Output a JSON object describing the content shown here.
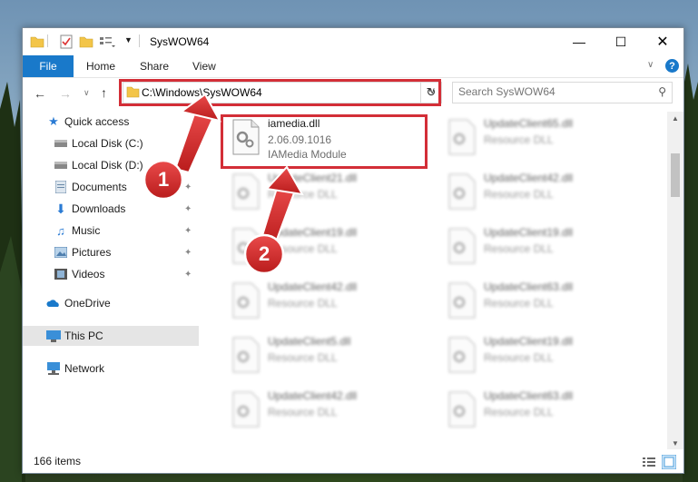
{
  "window": {
    "title": "SysWOW64"
  },
  "ribbon": {
    "file": "File",
    "home": "Home",
    "share": "Share",
    "view": "View"
  },
  "navigation": {
    "address_path": "C:\\Windows\\SysWOW64",
    "search_placeholder": "Search SysWOW64"
  },
  "sidebar": {
    "items": [
      {
        "label": "Quick access",
        "icon": "star-icon"
      },
      {
        "label": "Local Disk (C:)",
        "icon": "drive-icon"
      },
      {
        "label": "Local Disk (D:)",
        "icon": "drive-icon"
      },
      {
        "label": "Documents",
        "icon": "documents-icon"
      },
      {
        "label": "Downloads",
        "icon": "download-icon"
      },
      {
        "label": "Music",
        "icon": "music-icon"
      },
      {
        "label": "Pictures",
        "icon": "pictures-icon"
      },
      {
        "label": "Videos",
        "icon": "videos-icon"
      },
      {
        "label": "OneDrive",
        "icon": "cloud-icon"
      },
      {
        "label": "This PC",
        "icon": "computer-icon"
      },
      {
        "label": "Network",
        "icon": "network-icon"
      }
    ]
  },
  "files": {
    "highlighted": {
      "name": "iamedia.dll",
      "version": "2.06.09.1016",
      "description": "IAMedia Module"
    },
    "blurred": [
      {
        "name": "UpdateClient65.dll",
        "type": "Resource DLL"
      },
      {
        "name": "UpdateClient21.dll",
        "type": "Resource DLL"
      },
      {
        "name": "UpdateClient42.dll",
        "type": "Resource DLL"
      },
      {
        "name": "UpdateClient19.dll",
        "type": "Resource DLL"
      },
      {
        "name": "UpdateClient19.dll",
        "type": "Resource DLL"
      },
      {
        "name": "UpdateClient42.dll",
        "type": "Resource DLL"
      },
      {
        "name": "UpdateClient63.dll",
        "type": "Resource DLL"
      },
      {
        "name": "UpdateClient5.dll",
        "type": "Resource DLL"
      },
      {
        "name": "UpdateClient19.dll",
        "type": "Resource DLL"
      },
      {
        "name": "UpdateClient42.dll",
        "type": "Resource DLL"
      },
      {
        "name": "UpdateClient63.dll",
        "type": "Resource DLL"
      }
    ]
  },
  "status": {
    "item_count": "166 items"
  },
  "annotations": {
    "step1": "1",
    "step2": "2"
  },
  "colors": {
    "accent": "#1979ca",
    "highlight_red": "#d32e37"
  }
}
